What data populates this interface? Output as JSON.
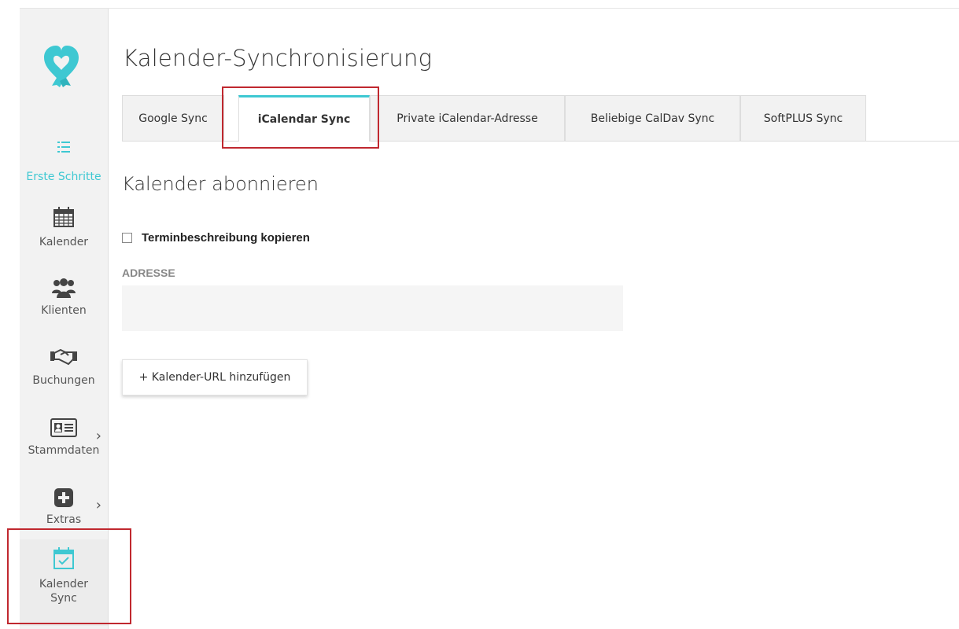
{
  "page_title": "Kalender-Synchronisierung",
  "sidebar": {
    "items": [
      {
        "label": "Erste Schritte",
        "icon": "list-icon",
        "active": true
      },
      {
        "label": "Kalender",
        "icon": "calendar-icon"
      },
      {
        "label": "Klienten",
        "icon": "users-icon"
      },
      {
        "label": "Buchungen",
        "icon": "handshake-icon"
      },
      {
        "label": "Stammdaten",
        "icon": "id-card-icon",
        "has_submenu": true
      },
      {
        "label": "Extras",
        "icon": "plus-square-icon",
        "has_submenu": true
      },
      {
        "label": "Kalender Sync",
        "label_line1": "Kalender",
        "label_line2": "Sync",
        "icon": "calendar-check-icon",
        "highlighted": true
      }
    ]
  },
  "tabs": [
    {
      "label": "Google Sync"
    },
    {
      "label": "iCalendar Sync",
      "active": true
    },
    {
      "label": "Private iCalendar-Adresse"
    },
    {
      "label": "Beliebige CalDav Sync"
    },
    {
      "label": "SoftPLUS Sync"
    }
  ],
  "section": {
    "title": "Kalender abonnieren",
    "checkbox_label": "Terminbeschreibung kopieren",
    "checkbox_checked": false,
    "address_label": "ADRESSE",
    "address_value": "",
    "add_button_label": "+ Kalender-URL hinzufügen"
  },
  "colors": {
    "accent": "#3ec8d2",
    "highlight_box": "#c0282f",
    "sidebar_bg": "#f2f2f2"
  }
}
